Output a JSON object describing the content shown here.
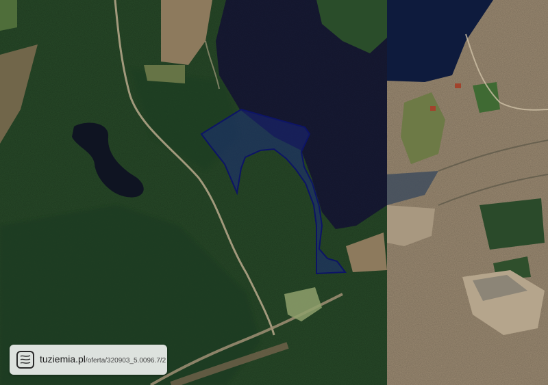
{
  "map": {
    "type": "satellite-view",
    "colors": {
      "forest": "#274a28",
      "forest_dark": "#1c381e",
      "lake": "#171a34",
      "lake_water": "#0e1b3d",
      "field": "#8d7a5d",
      "bare_ground": "#9b8a72",
      "parcel_fill": "#1b2a8c",
      "parcel_stroke": "#0d1466"
    }
  },
  "watermark": {
    "domain": "tuziemia.pl",
    "path": "/oferta/320903_5.0096.7/2",
    "logo_icon": "topo-lines-icon"
  }
}
